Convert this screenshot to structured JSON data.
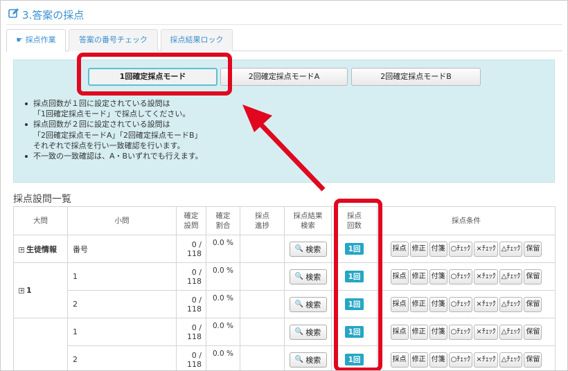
{
  "page": {
    "title": "3.答案の採点",
    "accent": "#3a8fd1"
  },
  "tabs": [
    "採点作業",
    "答案の番号チェック",
    "採点結果ロック"
  ],
  "modes": [
    "1回確定採点モード",
    "2回確定採点モードA",
    "2回確定採点モードB"
  ],
  "notes": [
    "採点回数が１回に設定されている設問は",
    "「1回確定採点モード」で採点してください。",
    "採点回数が２回に設定されている設問は",
    "「2回確定採点モードA」「2回確定採点モードB」",
    "それぞれで採点を行い一致確認を行います。",
    "不一致の一致確認は、A・Bいずれでも行えます。"
  ],
  "section_title": "採点設問一覧",
  "columns": {
    "big": "大問",
    "small": "小問",
    "confirmed": [
      "確定",
      "設問"
    ],
    "rate": [
      "確定",
      "割合"
    ],
    "progress": [
      "採点",
      "進捗"
    ],
    "search": [
      "採点結果",
      "検索"
    ],
    "count": [
      "採点",
      "回数"
    ],
    "conditions": "採点条件"
  },
  "groups": [
    {
      "label": "生徒情報",
      "rows": [
        {
          "small": "番号",
          "confirmed": "0 / 118",
          "rate": "0.0 %"
        }
      ]
    },
    {
      "label": "1",
      "rows": [
        {
          "small": "1",
          "confirmed": "0 / 118",
          "rate": "0.0 %"
        },
        {
          "small": "2",
          "confirmed": "0 / 118",
          "rate": "0.0 %"
        }
      ]
    },
    {
      "label": "",
      "rows": [
        {
          "small": "1",
          "confirmed": "0 / 118",
          "rate": "0.0 %"
        },
        {
          "small": "2",
          "confirmed": "0 / 118",
          "rate": "0.0 %"
        }
      ]
    }
  ],
  "search_label": "検索",
  "count_label": "1回",
  "conditions": [
    "採点",
    "修正",
    "付箋",
    "○ﾁｪｯｸ",
    "×ﾁｪｯｸ",
    "△ﾁｪｯｸ",
    "保留"
  ],
  "annotation_color": "#e0071f"
}
